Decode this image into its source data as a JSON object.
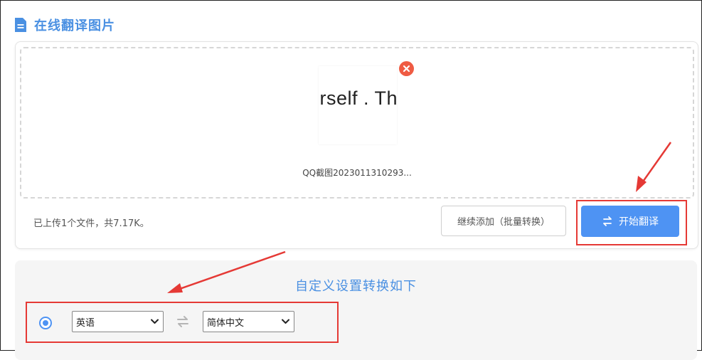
{
  "header": {
    "title": "在线翻译图片",
    "icon": "document-icon"
  },
  "upload": {
    "thumbnail_text": "urself . Th",
    "file_name": "QQ截图2023011310293...",
    "status": "已上传1个文件，共7.17K。",
    "add_more_label": "继续添加（批量转换）",
    "start_label": "开始翻译"
  },
  "settings": {
    "title": "自定义设置转换如下",
    "source_language": "英语",
    "target_language": "简体中文"
  },
  "colors": {
    "accent": "#4a90e2",
    "primary_button": "#4e93f3",
    "remove": "#ef5b43",
    "annotation": "#e53935"
  }
}
